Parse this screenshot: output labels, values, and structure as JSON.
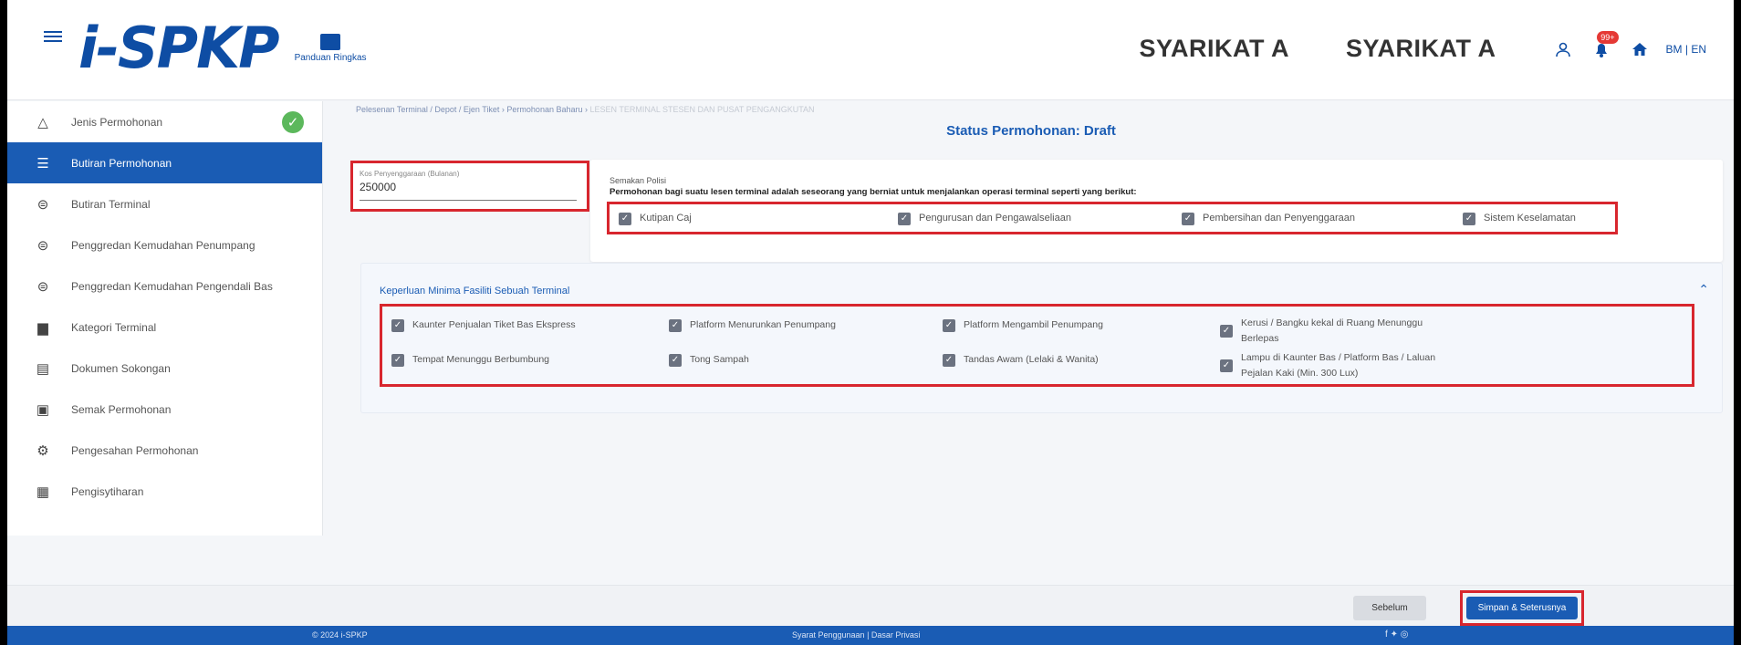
{
  "header": {
    "logo_text": "i-SPKP",
    "guide_label": "Panduan Ringkas",
    "company_1": "SYARIKAT A",
    "company_2": "SYARIKAT A",
    "notification_count": "99+",
    "language": "BM | EN"
  },
  "sidebar": {
    "items": [
      {
        "label": "Jenis Permohonan",
        "icon": "warning-triangle-icon",
        "completed": true
      },
      {
        "label": "Butiran Permohonan",
        "icon": "filter-icon",
        "active": true
      },
      {
        "label": "Butiran Terminal",
        "icon": "bus-icon"
      },
      {
        "label": "Penggredan Kemudahan Penumpang",
        "icon": "bus-icon"
      },
      {
        "label": "Penggredan Kemudahan Pengendali Bas",
        "icon": "bus-icon"
      },
      {
        "label": "Kategori Terminal",
        "icon": "document-icon"
      },
      {
        "label": "Dokumen Sokongan",
        "icon": "folder-icon"
      },
      {
        "label": "Semak Permohonan",
        "icon": "screen-icon"
      },
      {
        "label": "Pengesahan Permohonan",
        "icon": "gear-icon"
      },
      {
        "label": "Pengisytiharan",
        "icon": "clipboard-icon"
      }
    ]
  },
  "main": {
    "breadcrumb": "Pelesenan Terminal / Depot / Ejen Tiket › Permohonan Baharu › ",
    "breadcrumb_muted": "LESEN TERMINAL STESEN DAN PUSAT PENGANGKUTAN",
    "status_title": "Status Permohonan: Draft",
    "capacity_label": "Kos Penyenggaraan (Bulanan)",
    "capacity_value": "250000",
    "policy_small": "Semakan Polisi",
    "policy_text": "Permohonan bagi suatu lesen terminal adalah seseorang yang berniat untuk menjalankan operasi terminal seperti yang berikut:",
    "policy_checks": [
      "Kutipan Caj",
      "Pengurusan dan Pengawalseliaan",
      "Pembersihan dan Penyenggaraan",
      "Sistem Keselamatan"
    ],
    "facility_title": "Keperluan Minima Fasiliti Sebuah Terminal",
    "facilities": [
      "Kaunter Penjualan Tiket Bas Ekspress",
      "Platform Menurunkan Penumpang",
      "Platform Mengambil Penumpang",
      "Kerusi / Bangku kekal di Ruang Menunggu Berlepas",
      "Tempat Menunggu Berbumbung",
      "Tong Sampah",
      "Tandas Awam (Lelaki & Wanita)",
      "Lampu di Kaunter Bas / Platform Bas / Laluan Pejalan Kaki (Min. 300 Lux)"
    ]
  },
  "actions": {
    "back_label": "Sebelum",
    "next_label": "Simpan & Seterusnya"
  },
  "footer": {
    "copyright": "© 2024 i-SPKP",
    "links": "Syarat Penggunaan | Dasar Privasi"
  },
  "colors": {
    "primary": "#1a5cb4",
    "highlight_border": "#d8262e",
    "success": "#5cb85c"
  }
}
